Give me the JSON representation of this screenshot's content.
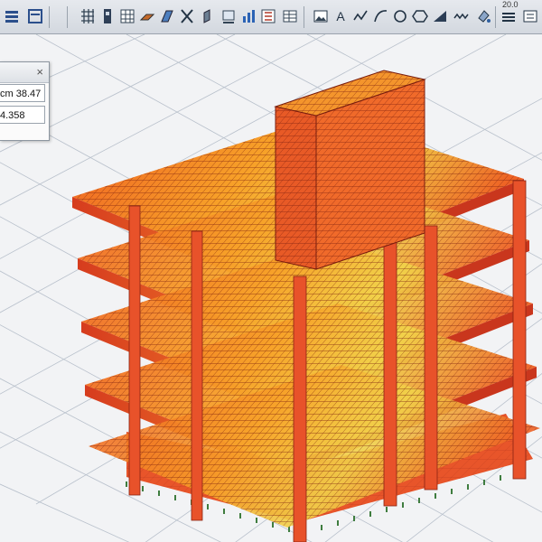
{
  "toolbar": {
    "font_size_value": "20.0",
    "text_tool_glyph": "A",
    "icons": [
      "toolbar-icon",
      "grid-icon",
      "column-icon",
      "beam-icon",
      "slab-icon",
      "wall-icon",
      "brace-icon",
      "node-icon",
      "support-icon",
      "load-icon",
      "section-icon",
      "picture-icon",
      "text-icon",
      "polyline-icon",
      "arc-icon",
      "circle-icon",
      "fill-icon",
      "dimension-icon",
      "layers-icon",
      "options-icon"
    ]
  },
  "properties_panel": {
    "close_glyph": "×",
    "field1_value": "38.47 cm",
    "field2_value": "4.358"
  },
  "model_view": {
    "description_colors": {
      "structure_dark": "#c7301c",
      "structure_mid": "#ee5a22",
      "structure_light": "#f7a128",
      "structure_yellow": "#f1d34a",
      "grid": "#b9c1cc",
      "supports": "#3f7d3f"
    }
  }
}
